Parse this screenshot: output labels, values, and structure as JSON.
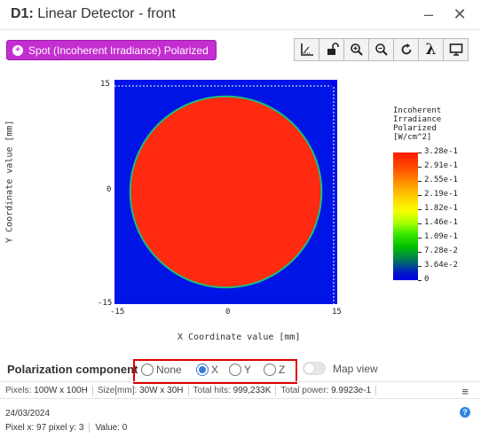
{
  "window": {
    "title_prefix": "D1:",
    "title_text": "Linear Detector - front"
  },
  "spot_button": {
    "label": "Spot (Incoherent Irradiance) Polarized",
    "icon": "plus-circle-icon"
  },
  "toolbar": {
    "tools": [
      {
        "name": "axes-icon",
        "glyph": "⊾"
      },
      {
        "name": "unlock-icon",
        "glyph": "🔓"
      },
      {
        "name": "zoom-in-icon",
        "glyph": "⊕"
      },
      {
        "name": "zoom-out-icon",
        "glyph": "⊖"
      },
      {
        "name": "refresh-icon",
        "glyph": "↻"
      },
      {
        "name": "lambda-icon",
        "glyph": "λ"
      },
      {
        "name": "monitor-icon",
        "glyph": "▭"
      }
    ]
  },
  "chart_data": {
    "type": "heatmap",
    "xlabel": "X Coordinate value [mm]",
    "ylabel": "Y Coordinate value [mm]",
    "xlim": [
      -15,
      15
    ],
    "ylim": [
      -15,
      15
    ],
    "xticks": [
      "-15",
      "0",
      "15"
    ],
    "yticks": [
      "15",
      "0",
      "-15"
    ],
    "description": "uniform circular spot centered at origin, radius ~13 mm",
    "spot": {
      "center": [
        0,
        0
      ],
      "radius": 13,
      "value": 0.328
    },
    "background_value": 0,
    "colorbar": {
      "title": [
        "Incoherent",
        "Irradiance",
        "Polarized",
        "[W/cm^2]"
      ],
      "labels": [
        "3.28e-1",
        "2.91e-1",
        "2.55e-1",
        "2.19e-1",
        "1.82e-1",
        "1.46e-1",
        "1.09e-1",
        "7.28e-2",
        "3.64e-2",
        "0"
      ]
    }
  },
  "polarization": {
    "label": "Polarization component",
    "options": [
      "None",
      "X",
      "Y",
      "Z"
    ],
    "selected": "X"
  },
  "map_view": {
    "label": "Map view",
    "on": false
  },
  "status": {
    "pixels_label": "Pixels:",
    "pixels_value": "100W x 100H",
    "size_label": "Size[mm]:",
    "size_value": "30W x 30H",
    "hits_label": "Total hits:",
    "hits_value": "999,233K",
    "power_label": "Total power:",
    "power_value": "9.9923e-1"
  },
  "date": "24/03/2024",
  "pixel_info": {
    "pos": "Pixel x: 97 pixel y: 3",
    "value": "Value: 0"
  }
}
